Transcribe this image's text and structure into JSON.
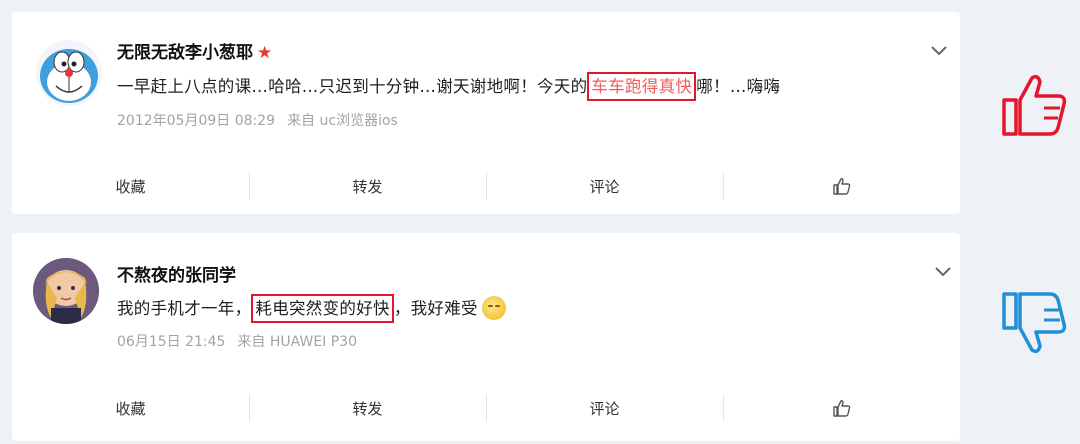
{
  "posts": [
    {
      "username": "无限无敌李小葱耶",
      "text_before": "一早赶上八点的课…哈哈…只迟到十分钟…谢天谢地啊！今天的",
      "text_highlight": "车车跑得真快",
      "text_after": "哪！…嗨嗨",
      "date": "2012年05月09日 08:29",
      "source": "来自 uc浏览器ios",
      "actions": [
        "收藏",
        "转发",
        "评论"
      ]
    },
    {
      "username": "不熬夜的张同学",
      "text_before": "我的手机才一年，",
      "text_highlight": "耗电突然变的好快",
      "text_after": "，我好难受",
      "date": "06月15日 21:45",
      "source": "来自 HUAWEI P30",
      "actions": [
        "收藏",
        "转发",
        "评论"
      ]
    }
  ],
  "colors": {
    "highlight_box": "#e3162b",
    "thumb_up": "#e3162b",
    "thumb_down": "#1e90d6",
    "vip_star": "#e8382f"
  },
  "icons": {
    "vip": "star-icon",
    "more": "chevron-down-icon",
    "like": "thumbs-up-icon",
    "positive": "thumbs-up-icon",
    "negative": "thumbs-down-icon"
  }
}
